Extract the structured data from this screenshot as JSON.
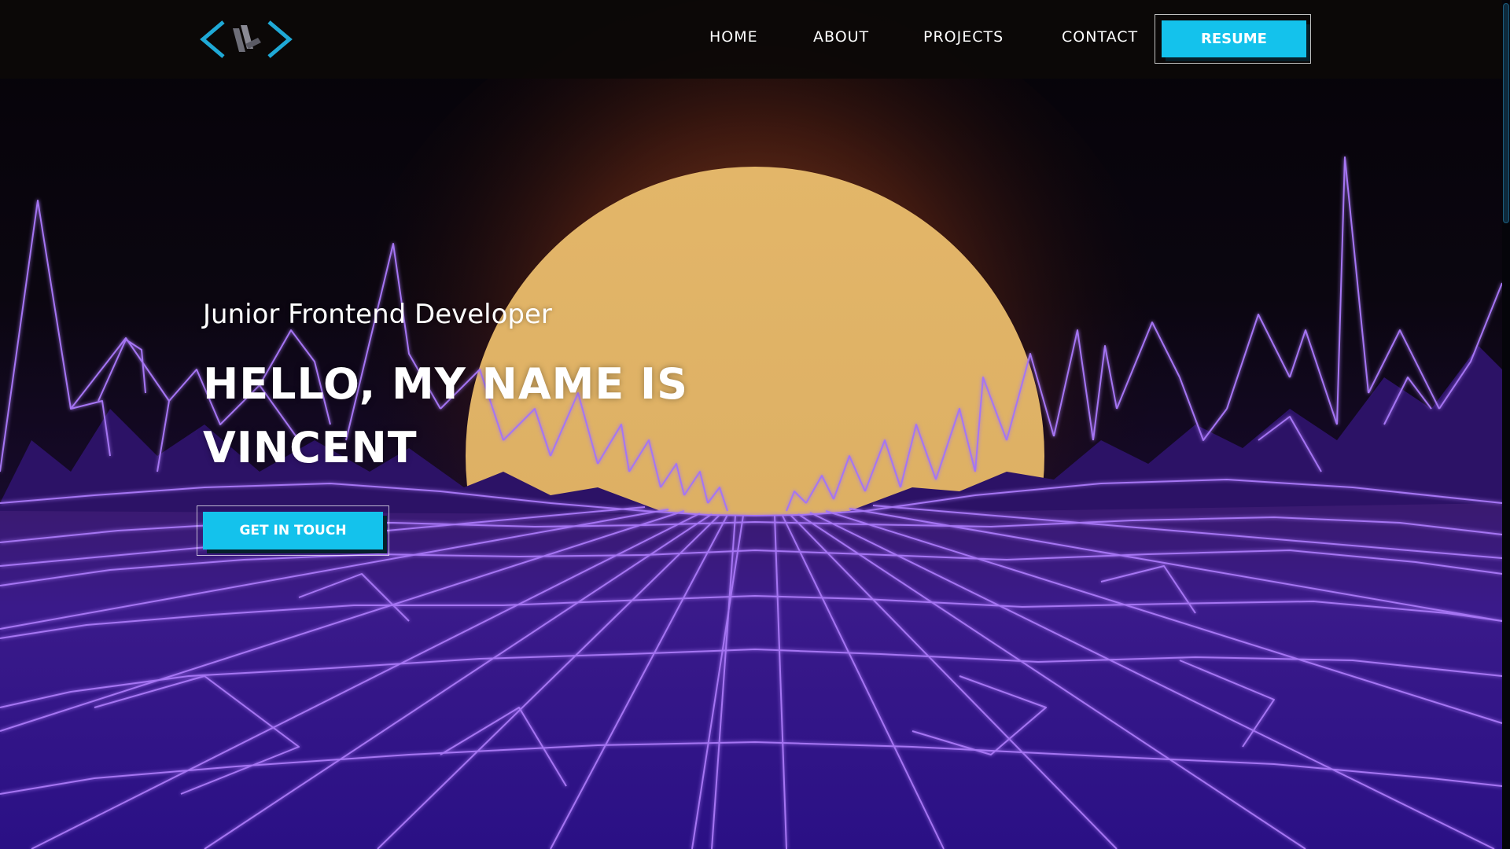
{
  "nav": {
    "items": [
      {
        "label": "HOME"
      },
      {
        "label": "ABOUT"
      },
      {
        "label": "PROJECTS"
      },
      {
        "label": "CONTACT"
      }
    ],
    "resume_label": "RESUME"
  },
  "hero": {
    "subtitle": "Junior Frontend Developer",
    "title_line1": "HELLO, MY NAME IS",
    "title_line2": "VINCENT",
    "cta_label": "GET IN TOUCH"
  },
  "colors": {
    "accent": "#14c2ec",
    "sun": "#e0b466",
    "grid": "#a572f2",
    "ground": "#3a1a8c",
    "navbar": "#0c0908"
  },
  "icons": {
    "logo": "code-brackets-logo"
  }
}
